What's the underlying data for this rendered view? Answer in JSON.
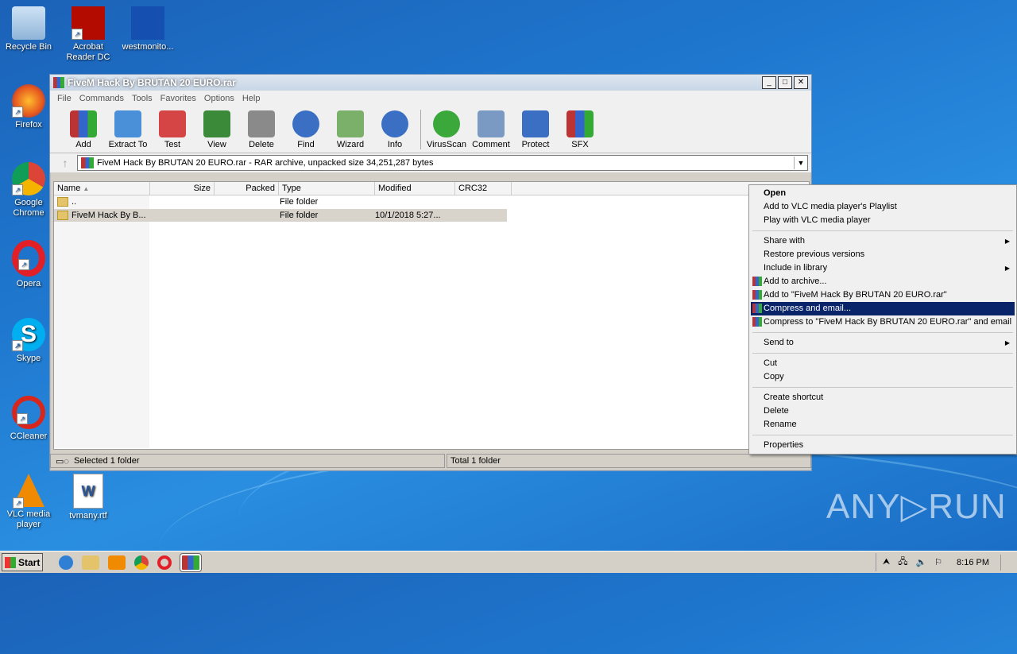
{
  "desktop": {
    "icons": [
      {
        "label": "Recycle Bin",
        "icon": "recycle-bin-icon"
      },
      {
        "label": "Acrobat Reader DC",
        "icon": "acrobat-icon"
      },
      {
        "label": "westmonito...",
        "icon": "file-icon"
      },
      {
        "label": "Firefox",
        "icon": "firefox-icon"
      },
      {
        "label": "Google Chrome",
        "icon": "chrome-icon"
      },
      {
        "label": "Opera",
        "icon": "opera-icon"
      },
      {
        "label": "Skype",
        "icon": "skype-icon"
      },
      {
        "label": "CCleaner",
        "icon": "ccleaner-icon"
      },
      {
        "label": "VLC media player",
        "icon": "vlc-icon"
      },
      {
        "label": "tvmany.rtf",
        "icon": "word-doc-icon"
      }
    ],
    "watermark": "ANY▷RUN"
  },
  "window": {
    "title": "FiveM Hack By BRUTAN 20 EURO.rar",
    "menu": [
      "File",
      "Commands",
      "Tools",
      "Favorites",
      "Options",
      "Help"
    ],
    "toolbar": [
      {
        "label": "Add",
        "color": "#c0392b"
      },
      {
        "label": "Extract To",
        "color": "#4a90d9"
      },
      {
        "label": "Test",
        "color": "#d64545"
      },
      {
        "label": "View",
        "color": "#3a8a3a"
      },
      {
        "label": "Delete",
        "color": "#8a8a8a"
      },
      {
        "label": "Find",
        "color": "#3a6fc4"
      },
      {
        "label": "Wizard",
        "color": "#7ab06a"
      },
      {
        "label": "Info",
        "color": "#3a6fc4"
      },
      {
        "label": "VirusScan",
        "color": "#3aa83a"
      },
      {
        "label": "Comment",
        "color": "#7a9ac4"
      },
      {
        "label": "Protect",
        "color": "#3a6fc4"
      },
      {
        "label": "SFX",
        "color": "#c0392b"
      }
    ],
    "address": "FiveM Hack By BRUTAN 20 EURO.rar - RAR archive, unpacked size 34,251,287 bytes",
    "columns": [
      "Name",
      "Size",
      "Packed",
      "Type",
      "Modified",
      "CRC32"
    ],
    "rows": [
      {
        "name": "..",
        "size": "",
        "packed": "",
        "type": "File folder",
        "modified": "",
        "crc": ""
      },
      {
        "name": "FiveM Hack By B...",
        "size": "",
        "packed": "",
        "type": "File folder",
        "modified": "10/1/2018 5:27...",
        "crc": ""
      }
    ],
    "status_left": "Selected 1 folder",
    "status_right": "Total 1 folder"
  },
  "context_menu": {
    "items": [
      {
        "label": "Open",
        "bold": true
      },
      {
        "label": "Add to VLC media player's Playlist"
      },
      {
        "label": "Play with VLC media player"
      },
      {
        "label": "Share with",
        "submenu": true
      },
      {
        "label": "Restore previous versions"
      },
      {
        "label": "Include in library",
        "submenu": true
      },
      {
        "label": "Add to archive...",
        "icon": "winrar-icon"
      },
      {
        "label": "Add to \"FiveM Hack By BRUTAN 20 EURO.rar\"",
        "icon": "winrar-icon"
      },
      {
        "label": "Compress and email...",
        "icon": "winrar-icon",
        "highlighted": true
      },
      {
        "label": "Compress to \"FiveM Hack By BRUTAN 20 EURO.rar\" and email",
        "icon": "winrar-icon"
      },
      {
        "label": "Send to",
        "submenu": true
      },
      {
        "label": "Cut"
      },
      {
        "label": "Copy"
      },
      {
        "label": "Create shortcut"
      },
      {
        "label": "Delete"
      },
      {
        "label": "Rename"
      },
      {
        "label": "Properties"
      }
    ]
  },
  "taskbar": {
    "start_label": "Start",
    "clock": "8:16 PM"
  }
}
